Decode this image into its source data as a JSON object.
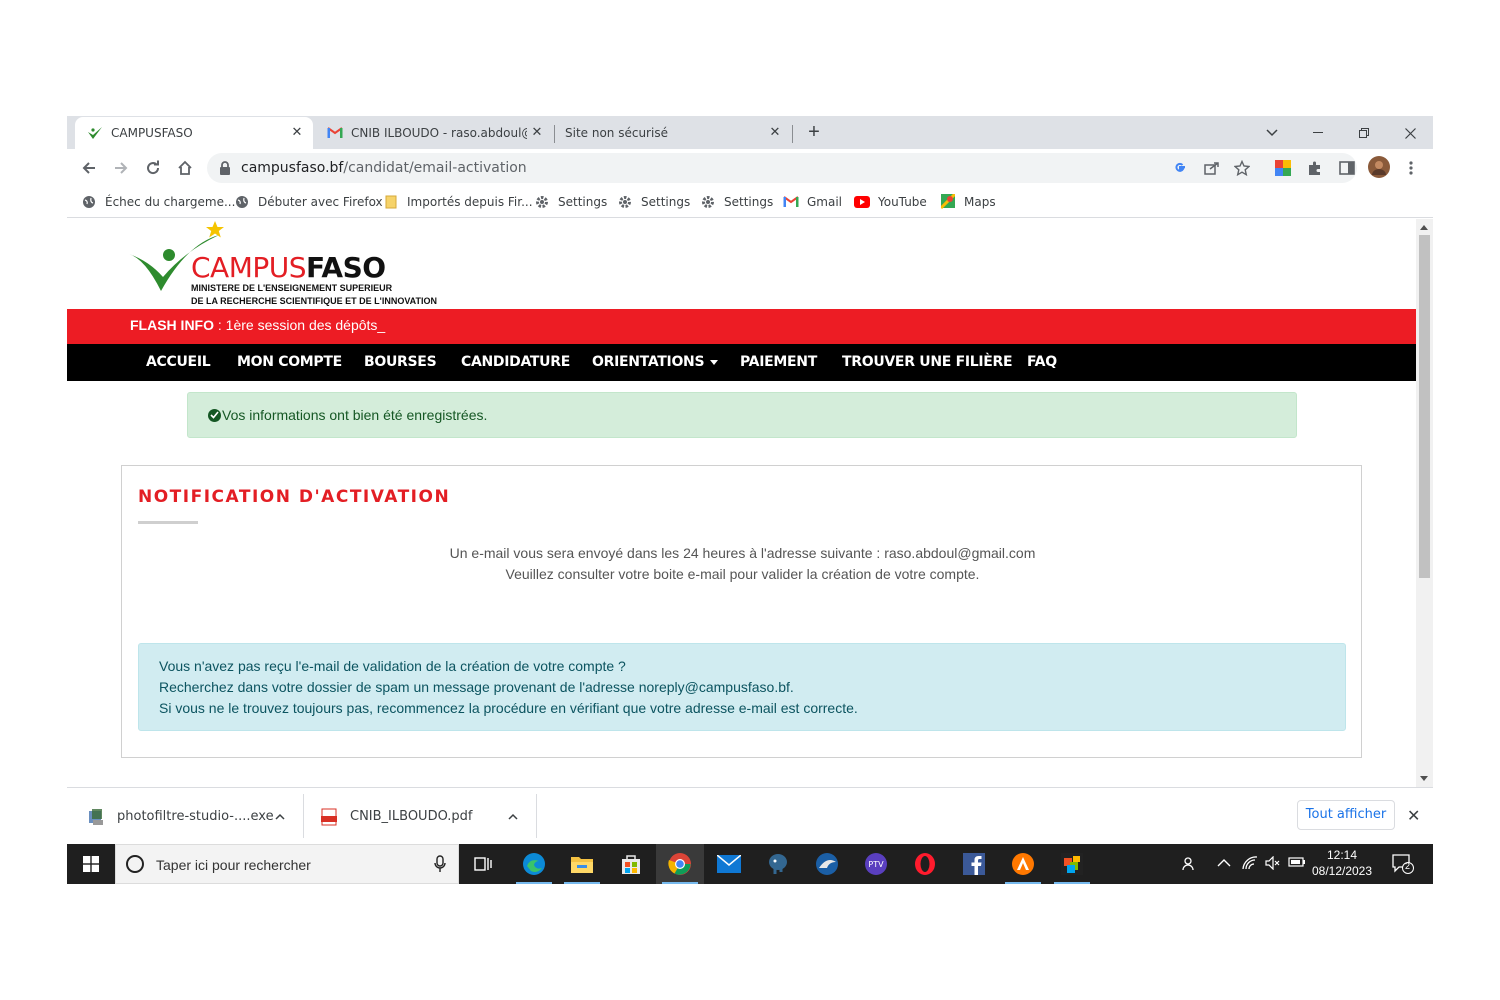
{
  "browser": {
    "tabs": [
      {
        "title": "CAMPUSFASO",
        "icon": "campusfaso-favicon"
      },
      {
        "title": "CNIB ILBOUDO - raso.abdoul@gm",
        "icon": "gmail-icon"
      },
      {
        "title": "Site non sécurisé",
        "icon": ""
      }
    ],
    "url_host": "campusfaso.bf",
    "url_path": "/candidat/email-activation",
    "bookmarks": [
      {
        "label": "Échec du chargeme...",
        "icon": "globe-icon"
      },
      {
        "label": "Débuter avec Firefox",
        "icon": "globe-icon"
      },
      {
        "label": "Importés depuis Fir...",
        "icon": "folder-icon"
      },
      {
        "label": "Settings",
        "icon": "gear-icon"
      },
      {
        "label": "Settings",
        "icon": "gear-icon"
      },
      {
        "label": "Settings",
        "icon": "gear-icon"
      },
      {
        "label": "Gmail",
        "icon": "gmail-icon"
      },
      {
        "label": "YouTube",
        "icon": "youtube-icon"
      },
      {
        "label": "Maps",
        "icon": "maps-icon"
      }
    ]
  },
  "site": {
    "logo": {
      "campus": "CAMPUS",
      "faso": "FASO",
      "line1": "MINISTERE DE L'ENSEIGNEMENT SUPERIEUR",
      "line2": "DE LA RECHERCHE SCIENTIFIQUE ET DE L'INNOVATION"
    },
    "flash_label": "FLASH INFO",
    "flash_text": " : 1ère session des dépôts_",
    "nav": [
      "ACCUEIL",
      "MON COMPTE",
      "BOURSES",
      "CANDIDATURE",
      "ORIENTATIONS",
      "PAIEMENT",
      "TROUVER UNE FILIÈRE",
      "FAQ"
    ],
    "success_message": "Vos informations ont bien été enregistrées.",
    "card": {
      "title": "NOTIFICATION D'ACTIVATION",
      "line1": "Un e-mail vous sera envoyé dans les 24 heures à l'adresse suivante : raso.abdoul@gmail.com",
      "line2": "Veuillez consulter votre boite e-mail pour valider la création de votre compte.",
      "info": [
        "Vous n'avez pas reçu l'e-mail de validation de la création de votre compte ?",
        "Recherchez dans votre dossier de spam un message provenant de l'adresse noreply@campusfaso.bf.",
        "Si vous ne le trouvez toujours pas, recommencez la procédure en vérifiant que votre adresse e-mail est correcte."
      ]
    }
  },
  "downloads": {
    "items": [
      {
        "name": "photofiltre-studio-....exe",
        "icon": "installer-icon"
      },
      {
        "name": "CNIB_ILBOUDO.pdf",
        "icon": "pdf-icon"
      }
    ],
    "show_all": "Tout afficher"
  },
  "taskbar": {
    "search_placeholder": "Taper ici pour rechercher",
    "time": "12:14",
    "date": "08/12/2023",
    "notification_count": "2"
  },
  "colors": {
    "brand_red": "#ed1c24",
    "brand_green": "#2e8b2e",
    "nav_black": "#000000",
    "success_bg": "#d4edda",
    "info_bg": "#d1ecf1"
  }
}
